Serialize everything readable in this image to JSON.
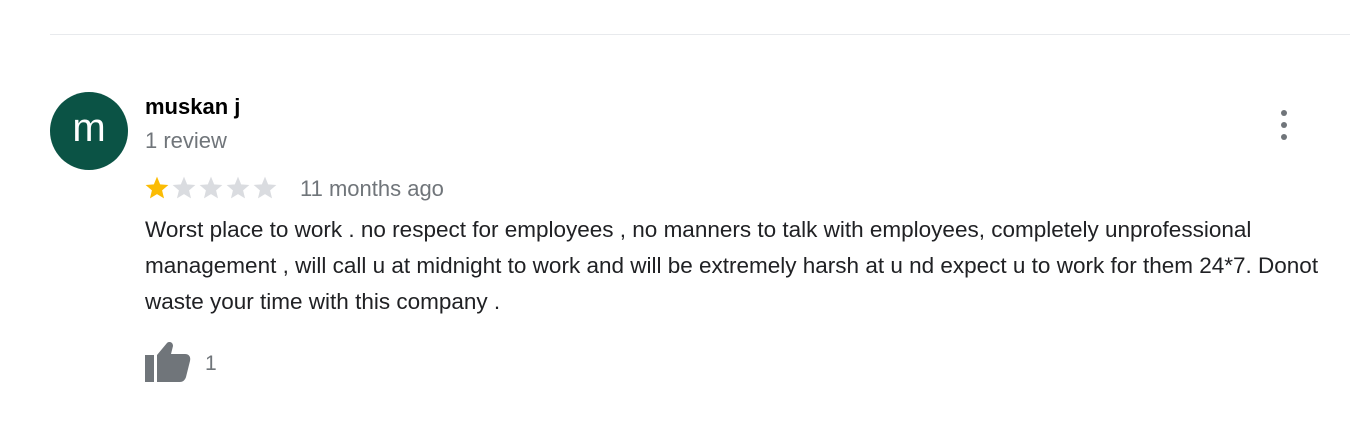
{
  "review": {
    "author": {
      "initial": "m",
      "name": "muskan j",
      "review_count": "1 review",
      "avatar_color": "#0b5345"
    },
    "rating": {
      "value": 1,
      "max": 5,
      "filled_color": "#fbbc04",
      "empty_color": "#dadce0"
    },
    "date": "11 months ago",
    "text": "Worst place to work . no respect for employees , no manners to talk with employees, completely unprofessional management , will call u at midnight to work and will be extremely harsh at u nd expect u to work for them 24*7. Donot waste your time with this company .",
    "likes": {
      "count": "1",
      "icon": "thumbs-up-icon"
    },
    "menu_icon": "more-vertical-icon"
  }
}
